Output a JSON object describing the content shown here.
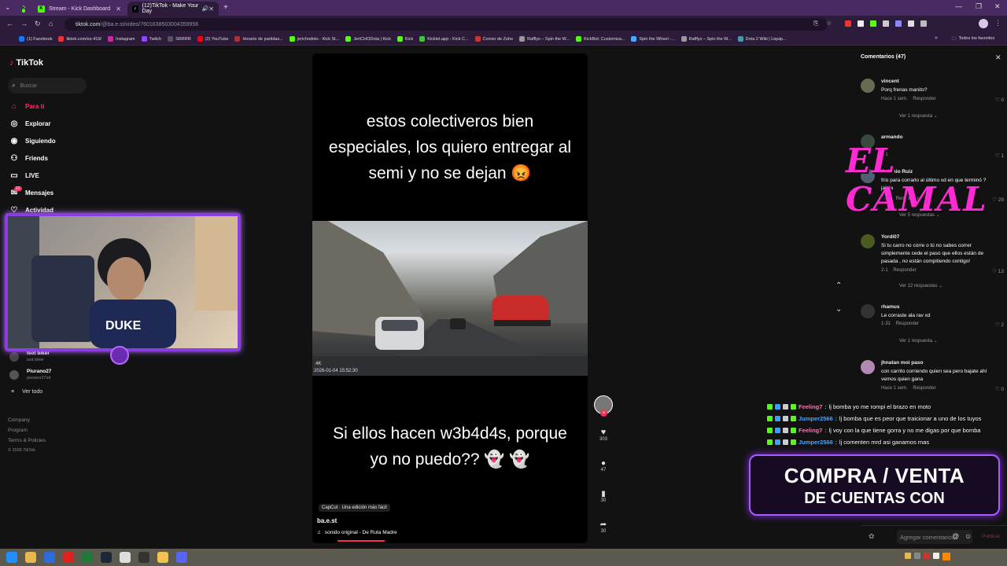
{
  "browser": {
    "tabs": [
      {
        "label": "Stream - Kick Dashboard",
        "active": false
      },
      {
        "label": "(12)TikTok - Make Your Day",
        "active": true
      }
    ],
    "url_host": "tiktok.com",
    "url_path": "/@ba.e.st/video/7601638503004359956",
    "bookmarks": [
      "(1) Facebook",
      "tiktok.com/es-419/",
      "Instagram",
      "Twitch",
      "SRRRR",
      "(2) YouTube",
      "Horario de partidas...",
      "jerichodoto - Kick St...",
      "JeriCHODota | Kick",
      "Kick",
      "Kicklet.app - Kick C...",
      "Correo de Zoho",
      "Rafflys – Spin the W...",
      "KickBot: Customiza...",
      "Spin the Wheel -...",
      "Rafflys – Spin the W...",
      "Dota 2 Wiki | Liquip..."
    ],
    "all_bookmarks": "Todos los favoritos"
  },
  "sidebar": {
    "logo": "TikTok",
    "search_placeholder": "Buscar",
    "items": [
      {
        "label": "Para ti",
        "icon": "home-icon",
        "active": true
      },
      {
        "label": "Explorar",
        "icon": "compass-icon"
      },
      {
        "label": "Siguiendo",
        "icon": "following-icon"
      },
      {
        "label": "Friends",
        "icon": "friends-icon"
      },
      {
        "label": "LIVE",
        "icon": "live-icon"
      },
      {
        "label": "Mensajes",
        "icon": "messages-icon",
        "badge": "12"
      },
      {
        "label": "Actividad",
        "icon": "activity-icon"
      }
    ],
    "following": [
      {
        "name": "Isot biker",
        "handle": "isot.biker"
      },
      {
        "name": "Piurano27",
        "handle": "piurano27xd"
      }
    ],
    "see_all": "Ver todo",
    "footer": [
      "Company",
      "Program",
      "Terms & Policies"
    ],
    "copyright": "© 2026 TikTok"
  },
  "video": {
    "top_text": "estos colectiveros bien especiales, los quiero entregar al semi y no se dejan 😡",
    "bottom_text": "Si ellos hacen w3b4d4s, porque yo no puedo?? 👻 👻",
    "badge_4k": "4K",
    "timestamp": "2026-01-04 15:52:30",
    "capcut": "CapCut · Una edición más fácil",
    "author": "ba.e.st",
    "sound": "sonido original - De Ruta Madre",
    "likes": "303",
    "comments": "47",
    "saves": "30",
    "shares": "30"
  },
  "comments_panel": {
    "title": "Comentarios (47)",
    "reply_label": "Responder",
    "comments": [
      {
        "user": "vincent",
        "text": "Porq frenas manito?",
        "date": "Hace 1 sem.",
        "likes": "0",
        "more": "Ver 1 respuesta"
      },
      {
        "user": "armando",
        "text": "",
        "date": "2-1",
        "likes": "1",
        "more": ""
      },
      {
        "user": "Antonio Ruiz",
        "text": "frío para corrarlo al último xd en que terminó ? jajaja",
        "date": "1-31",
        "likes": "29",
        "more": "Ver 5 respuestas"
      },
      {
        "user": "Yordi07",
        "text": "Si tu carro no corre o tú no sabes correr simplemente cede el paso que ellos están de pasada , no están compitiendo contigo!",
        "date": "2-1",
        "likes": "13",
        "more": "Ver 12 respuestas"
      },
      {
        "user": "rhamus",
        "text": "Le corraste ala rav xd",
        "date": "1-31",
        "likes": "2",
        "more": "Ver 1 respuesta"
      },
      {
        "user": "jhnatan moi paso",
        "text": "con carrito corriendo quien sea pero bajate ahí vemos quien gana",
        "date": "Hace 1 sem.",
        "likes": "0",
        "more": ""
      }
    ],
    "add_placeholder": "Agregar comentario...",
    "post_label": "Publicar"
  },
  "stream_overlay": {
    "brand": "EL CAMAL",
    "promo_line1": "COMPRA / VENTA",
    "promo_line2": "DE CUENTAS CON",
    "chat": [
      {
        "user": "Feeling7",
        "color": "#ff6fb5",
        "text": "lj bomba yo me rompi el brazo en moto"
      },
      {
        "user": "Jumper2566",
        "color": "#4aa3ff",
        "text": "lj bomba que es peor que traicionar a uno de los tuyos"
      },
      {
        "user": "Feeling7",
        "color": "#ff6fb5",
        "text": "lj voy con la que tiene gorra y no me digas por que bomba"
      },
      {
        "user": "Jumper2566",
        "color": "#4aa3ff",
        "text": "lj comenten mrd asi ganamos mas"
      }
    ]
  }
}
